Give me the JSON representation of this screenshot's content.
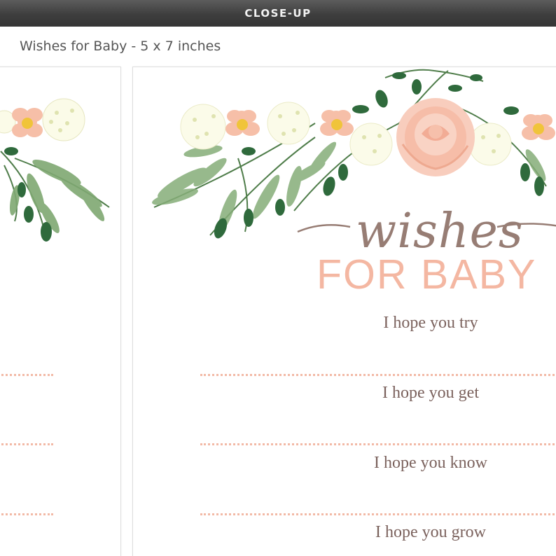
{
  "banner": {
    "label": "CLOSE-UP"
  },
  "product": {
    "title": "Wishes for Baby - 5 x 7 inches"
  },
  "card": {
    "title_script": "wishes",
    "title_caps": "FOR BABY",
    "prompts": [
      "I hope you try",
      "I hope you get",
      "I hope you know",
      "I hope you grow"
    ]
  },
  "colors": {
    "title_script": "#977d74",
    "title_caps": "#f4b7a2",
    "prompt_text": "#7b625d",
    "dotted_line": "#f2b9a6",
    "leaf_green": "#5a8a55",
    "rose": "#f6c3b0"
  }
}
